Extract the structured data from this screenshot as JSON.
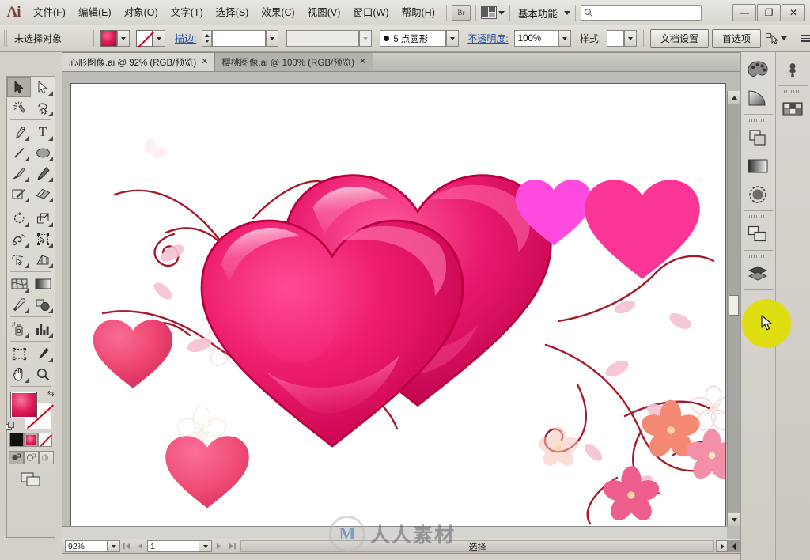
{
  "app": {
    "logo": "Ai",
    "name": "Adobe Illustrator"
  },
  "menubar": {
    "items": [
      {
        "label": "文件(F)",
        "name": "menu-file"
      },
      {
        "label": "编辑(E)",
        "name": "menu-edit"
      },
      {
        "label": "对象(O)",
        "name": "menu-object"
      },
      {
        "label": "文字(T)",
        "name": "menu-type"
      },
      {
        "label": "选择(S)",
        "name": "menu-select"
      },
      {
        "label": "效果(C)",
        "name": "menu-effect"
      },
      {
        "label": "视图(V)",
        "name": "menu-view"
      },
      {
        "label": "窗口(W)",
        "name": "menu-window"
      },
      {
        "label": "帮助(H)",
        "name": "menu-help"
      }
    ],
    "bridge_button": "Br",
    "arrange_documents_icon": "arrange-documents-icon",
    "workspace": "基本功能",
    "search_placeholder": "",
    "search_value": "",
    "window_buttons": {
      "minimize": "—",
      "maximize": "❐",
      "close": "✕"
    }
  },
  "controlbar": {
    "selection_status": "未选择对象",
    "fill_swatch_label": "填色",
    "stroke_swatch_label": "描边颜色",
    "stroke_label": "描边:",
    "stroke_weight_value": "",
    "stroke_profile_value": "",
    "brush_definition": "5 点圆形",
    "opacity_label": "不透明度:",
    "opacity_value": "100%",
    "style_label": "样式:",
    "style_value": "",
    "document_setup_button": "文档设置",
    "preferences_button": "首选项",
    "select_similar_icon": "select-similar-objects-icon",
    "panel_menu_icon": "panel-menu-icon"
  },
  "toolbox": {
    "tools": [
      {
        "name": "selection-tool",
        "label": "选择工具",
        "selected": true
      },
      {
        "name": "direct-selection-tool",
        "label": "直接选择工具",
        "selected": false
      },
      {
        "name": "magic-wand-tool",
        "label": "魔棒工具",
        "selected": false
      },
      {
        "name": "lasso-tool",
        "label": "套索工具",
        "selected": false
      },
      {
        "name": "pen-tool",
        "label": "钢笔工具",
        "selected": false
      },
      {
        "name": "type-tool",
        "label": "文字工具",
        "selected": false
      },
      {
        "name": "line-segment-tool",
        "label": "直线段工具",
        "selected": false
      },
      {
        "name": "ellipse-tool",
        "label": "椭圆工具",
        "selected": false
      },
      {
        "name": "paintbrush-tool",
        "label": "画笔工具",
        "selected": false
      },
      {
        "name": "pencil-tool",
        "label": "铅笔工具",
        "selected": false
      },
      {
        "name": "blob-brush-tool",
        "label": "斑点画笔工具",
        "selected": false
      },
      {
        "name": "eraser-tool",
        "label": "橡皮擦工具",
        "selected": false
      },
      {
        "name": "rotate-tool",
        "label": "旋转工具",
        "selected": false
      },
      {
        "name": "scale-tool",
        "label": "比例缩放工具",
        "selected": false
      },
      {
        "name": "width-tool",
        "label": "宽度工具",
        "selected": false
      },
      {
        "name": "free-transform-tool",
        "label": "自由变换工具",
        "selected": false
      },
      {
        "name": "shape-builder-tool",
        "label": "形状生成器工具",
        "selected": false
      },
      {
        "name": "perspective-grid-tool",
        "label": "透视网格工具",
        "selected": false
      },
      {
        "name": "mesh-tool",
        "label": "网格工具",
        "selected": false
      },
      {
        "name": "gradient-tool",
        "label": "渐变工具",
        "selected": false
      },
      {
        "name": "eyedropper-tool",
        "label": "吸管工具",
        "selected": false
      },
      {
        "name": "blend-tool",
        "label": "混合工具",
        "selected": false
      },
      {
        "name": "symbol-sprayer-tool",
        "label": "符号喷枪工具",
        "selected": false
      },
      {
        "name": "column-graph-tool",
        "label": "柱形图工具",
        "selected": false
      },
      {
        "name": "artboard-tool",
        "label": "画板工具",
        "selected": false
      },
      {
        "name": "slice-tool",
        "label": "切片工具",
        "selected": false
      },
      {
        "name": "hand-tool",
        "label": "抓手工具",
        "selected": false
      },
      {
        "name": "zoom-tool",
        "label": "缩放工具",
        "selected": false
      }
    ],
    "fill_stroke": {
      "fill_label": "填色",
      "stroke_label": "描边",
      "swap_label": "互换填色和描边",
      "default_label": "默认填色和描边"
    },
    "color_modes": [
      {
        "name": "color-mode",
        "label": "颜色"
      },
      {
        "name": "gradient-mode",
        "label": "渐变"
      },
      {
        "name": "none-mode",
        "label": "无"
      }
    ],
    "draw_modes": [
      {
        "name": "draw-normal-mode",
        "label": "正常绘图",
        "active": true
      },
      {
        "name": "draw-behind-mode",
        "label": "背面绘图",
        "active": false
      },
      {
        "name": "draw-inside-mode",
        "label": "内部绘图",
        "active": false
      }
    ],
    "screen_mode": {
      "name": "change-screen-mode",
      "label": "更改屏幕模式"
    }
  },
  "document": {
    "tabs": [
      {
        "title": "心形图像.ai @ 92% (RGB/预览)",
        "active": true,
        "close": "✕"
      },
      {
        "title": "樱桃图像.ai @ 100% (RGB/预览)",
        "active": false,
        "close": "✕"
      }
    ],
    "artwork_alt": "两颗粉色心形与樱花藤蔓插画"
  },
  "statusbar": {
    "zoom_value": "92%",
    "page_value": "1",
    "status_text": "选择",
    "first_page_icon": "first-page-icon",
    "prev_page_icon": "prev-page-icon",
    "next_page_icon": "next-page-icon",
    "last_page_icon": "last-page-icon"
  },
  "dock": {
    "column_one": [
      {
        "name": "color-panel-icon",
        "label": "颜色"
      },
      {
        "name": "color-guide-panel-icon",
        "label": "颜色参考"
      },
      {
        "name": "pathfinder-panel-icon",
        "label": "路径查找器"
      },
      {
        "name": "gradient-panel-icon",
        "label": "渐变"
      },
      {
        "name": "transparency-panel-icon",
        "label": "透明度"
      },
      {
        "name": "align-panel-icon",
        "label": "对齐"
      },
      {
        "name": "layers-panel-icon",
        "label": "图层"
      }
    ],
    "column_two": [
      {
        "name": "brushes-panel-icon",
        "label": "画笔"
      },
      {
        "name": "swatches-panel-icon",
        "label": "色板"
      }
    ]
  },
  "cursor": {
    "highlight_label": "光标高亮",
    "pointer_label": "鼠标指针"
  },
  "watermark": {
    "logo": "M",
    "text": "人人素材"
  },
  "colors": {
    "heart_deep_pink": "#e8257a",
    "heart_magenta": "#ff3399",
    "heart_light_magenta": "#ff4de0",
    "heart_rose": "#ef3d6e",
    "vine_dark_red": "#a61b2b",
    "blossom_salmon": "#f58b7e",
    "blossom_pink": "#f06a9a",
    "petal_pale": "#f8cfd8",
    "chrome": "#d4d0c8",
    "accent_link": "#1c4fa1",
    "highlight_yellow": "#dede13"
  }
}
